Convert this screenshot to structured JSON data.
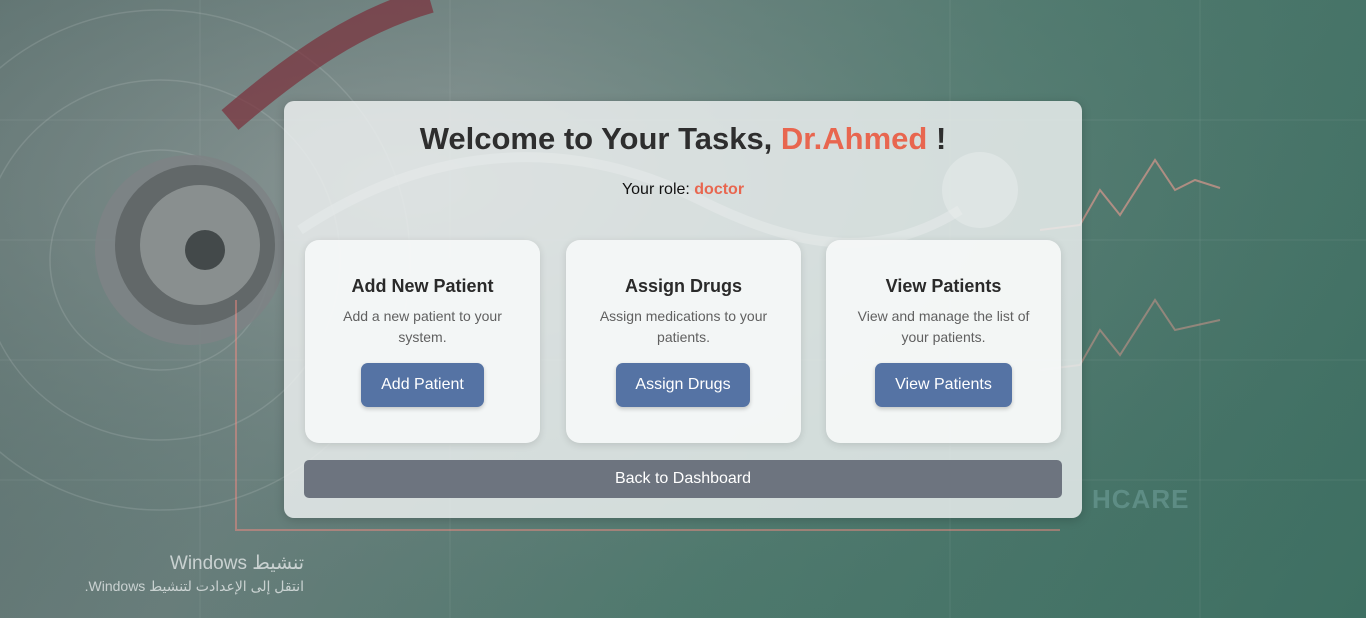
{
  "header": {
    "title_prefix": "Welcome to Your Tasks, ",
    "doctor_name": "Dr.Ahmed",
    "title_suffix": " !",
    "role_label": "Your role: ",
    "role_value": "doctor"
  },
  "cards": [
    {
      "title": "Add New Patient",
      "description": "Add a new patient to your system.",
      "button_label": "Add Patient"
    },
    {
      "title": "Assign Drugs",
      "description": "Assign medications to your patients.",
      "button_label": "Assign Drugs"
    },
    {
      "title": "View Patients",
      "description": "View and manage the list of your patients.",
      "button_label": "View Patients"
    }
  ],
  "back_button_label": "Back to Dashboard",
  "background_text": "HCARE",
  "watermark": {
    "title": "تنشيط Windows",
    "subtitle": "انتقل إلى الإعدادت لتنشيط Windows."
  },
  "colors": {
    "accent": "#e8664f",
    "primary_button": "#5573a4",
    "secondary_button": "#6d747f",
    "background": "#4f7a6e"
  }
}
